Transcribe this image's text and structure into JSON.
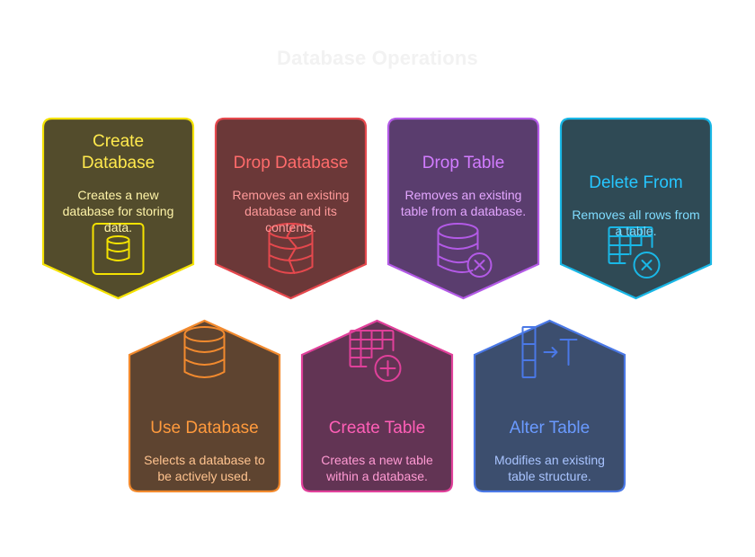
{
  "title": "Database Operations",
  "cards": [
    {
      "key": "create-database",
      "title": "Create Database",
      "desc": "Creates a new database for storing data.",
      "icon": "database-icon",
      "stroke": "#f4e200",
      "fill": "#534c2c",
      "text": "#ffe94d",
      "desc_color": "#fff4a8"
    },
    {
      "key": "drop-database",
      "title": "Drop Database",
      "desc": "Removes an existing database and its contents.",
      "icon": "broken-database-icon",
      "stroke": "#e5484d",
      "fill": "#6b3838",
      "text": "#ff6b6b",
      "desc_color": "#ff9a9a"
    },
    {
      "key": "drop-table",
      "title": "Drop Table",
      "desc": "Removes an existing table from a database.",
      "icon": "database-remove-icon",
      "stroke": "#b35ae6",
      "fill": "#5a3d6e",
      "text": "#d27cff",
      "desc_color": "#e3a6ff"
    },
    {
      "key": "delete-from",
      "title": "Delete From",
      "desc": "Removes all rows from a table.",
      "icon": "table-remove-icon",
      "stroke": "#19b7e6",
      "fill": "#2f4a55",
      "text": "#26c6ff",
      "desc_color": "#7fdcff"
    },
    {
      "key": "use-database",
      "title": "Use Database",
      "desc": "Selects a database to be actively used.",
      "icon": "database-icon",
      "stroke": "#f28a2e",
      "fill": "#5e4430",
      "text": "#ff9a3d",
      "desc_color": "#ffc38f"
    },
    {
      "key": "create-table",
      "title": "Create Table",
      "desc": "Creates a new table within a database.",
      "icon": "table-add-icon",
      "stroke": "#e0409a",
      "fill": "#623454",
      "text": "#ff5fb7",
      "desc_color": "#ff9ad3"
    },
    {
      "key": "alter-table",
      "title": "Alter Table",
      "desc": "Modifies an existing table structure.",
      "icon": "column-insert-icon",
      "stroke": "#4a78e6",
      "fill": "#3c4e6e",
      "text": "#6a9aff",
      "desc_color": "#a9c4ff"
    }
  ]
}
